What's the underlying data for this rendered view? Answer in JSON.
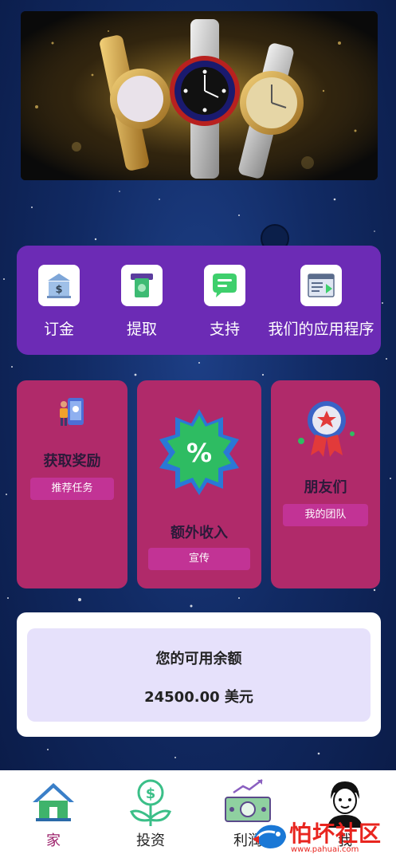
{
  "banner": {
    "image_alt": "watches"
  },
  "menu": {
    "items": [
      {
        "label": "订金",
        "icon": "bank-icon"
      },
      {
        "label": "提取",
        "icon": "cash-withdraw-icon"
      },
      {
        "label": "支持",
        "icon": "chat-bubble-icon"
      },
      {
        "label": "我们的应用程序",
        "icon": "app-window-icon"
      }
    ]
  },
  "cards": {
    "rewards": {
      "title": "获取奖励",
      "button": "推荐任务"
    },
    "income": {
      "title": "额外收入",
      "button": "宣传"
    },
    "friends": {
      "title": "朋友们",
      "button": "我的团队"
    }
  },
  "balance": {
    "title": "您的可用余额",
    "amount": "24500.00 美元"
  },
  "tabbar": {
    "items": [
      {
        "label": "家",
        "active": true,
        "color": "#9b1f6a"
      },
      {
        "label": "投资",
        "active": false
      },
      {
        "label": "利润",
        "active": false
      },
      {
        "label": "我",
        "active": false
      }
    ]
  },
  "watermark": {
    "text": "怕坏社区",
    "url": "www.pahuai.com"
  }
}
